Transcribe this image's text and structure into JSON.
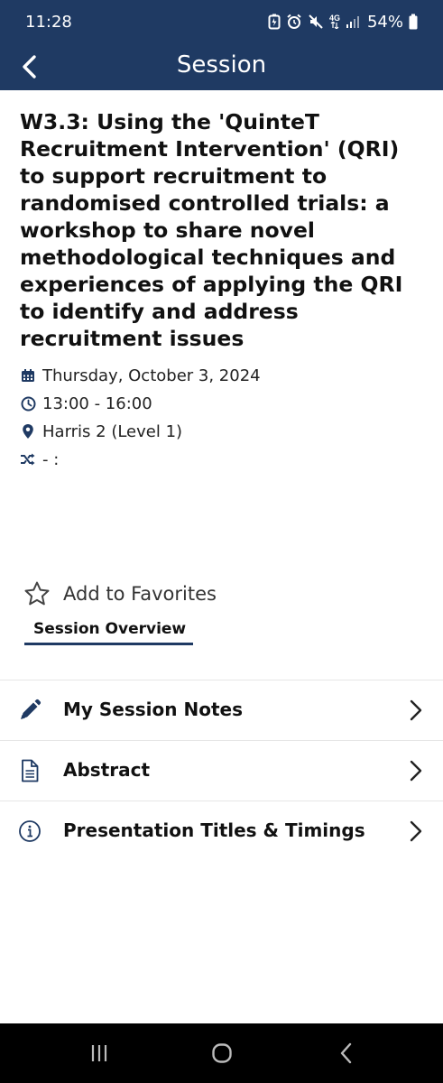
{
  "status_bar": {
    "time": "11:28",
    "network": "4G",
    "battery": "54%"
  },
  "app_bar": {
    "title": "Session"
  },
  "session": {
    "title": "W3.3: Using the 'QuinteT Recruitment Intervention' (QRI) to support recruitment to randomised controlled trials: a workshop to share novel methodological techniques and experiences of applying the QRI to identify and address recruitment issues",
    "date": "Thursday, October 3, 2024",
    "time": "13:00 - 16:00",
    "location": "Harris 2 (Level 1)",
    "track": "- :"
  },
  "favorites": {
    "label": "Add to Favorites"
  },
  "tabs": [
    {
      "label": "Session Overview",
      "active": true
    }
  ],
  "list_items": [
    {
      "label": "My Session Notes",
      "icon": "pencil-icon"
    },
    {
      "label": "Abstract",
      "icon": "document-icon"
    },
    {
      "label": "Presentation Titles & Timings",
      "icon": "info-icon"
    }
  ],
  "colors": {
    "header_bg": "#1f3a63",
    "accent": "#1f3a63",
    "nav_bg": "#000000"
  }
}
